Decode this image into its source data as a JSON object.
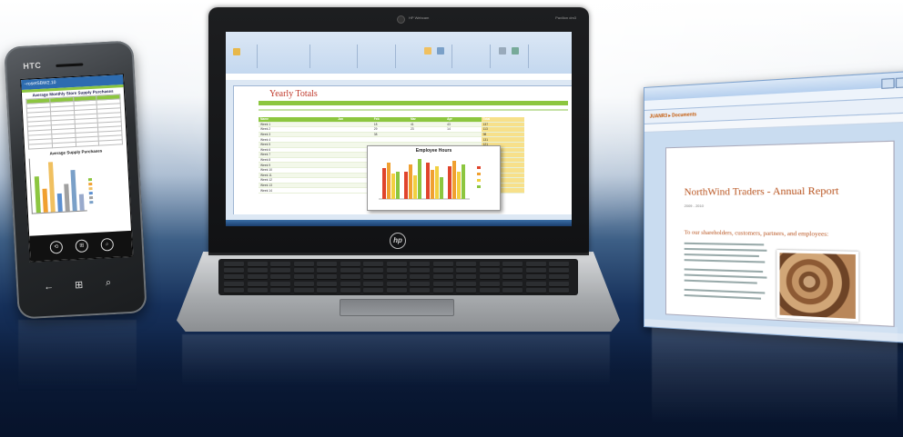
{
  "phone": {
    "brand": "HTC",
    "address": "~rosetSBW2.10",
    "table_title": "Average Monthly Store Supply Purchases",
    "chart_title": "Average Supply Purchases",
    "buttons": [
      "⟲",
      "⊞",
      "⌕"
    ],
    "hw_keys": [
      "←",
      "⊞",
      "⌕"
    ]
  },
  "laptop": {
    "brand_logo": "hp",
    "webcam_label": "HP Webcam",
    "model": "Pavilion dm3",
    "spreadsheet": {
      "title": "Yearly Totals",
      "header": [
        "Name",
        "Jan",
        "Feb",
        "Mar",
        "Apr",
        "Total"
      ],
      "rows": [
        [
          "Week 1",
          "",
          "",
          "18",
          "41",
          "43",
          "137"
        ],
        [
          "Week 2",
          "",
          "",
          "29",
          "23",
          "14",
          "113"
        ],
        [
          "Week 3",
          "",
          "",
          "38",
          "",
          "",
          "98"
        ],
        [
          "Week 4",
          "",
          "",
          "",
          "",
          "",
          "131"
        ],
        [
          "Week 5",
          "",
          "",
          "",
          "",
          "",
          "121"
        ],
        [
          "Week 6",
          "",
          "",
          "",
          "",
          "",
          "112"
        ],
        [
          "Week 7",
          "",
          "",
          "",
          "",
          "",
          "115"
        ],
        [
          "Week 8",
          "",
          "",
          "",
          "",
          "",
          "93"
        ],
        [
          "Week 9",
          "",
          "",
          "",
          "",
          "",
          "107"
        ],
        [
          "Week 10",
          "",
          "",
          "",
          "",
          "",
          "131"
        ],
        [
          "Week 11",
          "",
          "",
          "",
          "",
          "",
          "121"
        ],
        [
          "Week 12",
          "",
          "",
          "",
          "",
          "",
          "115"
        ],
        [
          "Week 13",
          "",
          "",
          "",
          "",
          "",
          "129"
        ],
        [
          "Week 14",
          "",
          "",
          "",
          "",
          "",
          "88"
        ]
      ],
      "chart_title": "Employee Hours"
    }
  },
  "browser": {
    "breadcrumb": "JUANR3 ▸ Documents",
    "doc_title": "NorthWind Traders - Annual Report",
    "doc_date": "2009 - 2010",
    "doc_subhead": "To our shareholders, customers, partners, and employees:"
  },
  "colors": {
    "excel_green": "#8cc63f",
    "title_red": "#c0392b",
    "report_orange": "#b8531e",
    "series": [
      "#e0442c",
      "#f0a030",
      "#f2d040",
      "#8cc63f"
    ]
  }
}
